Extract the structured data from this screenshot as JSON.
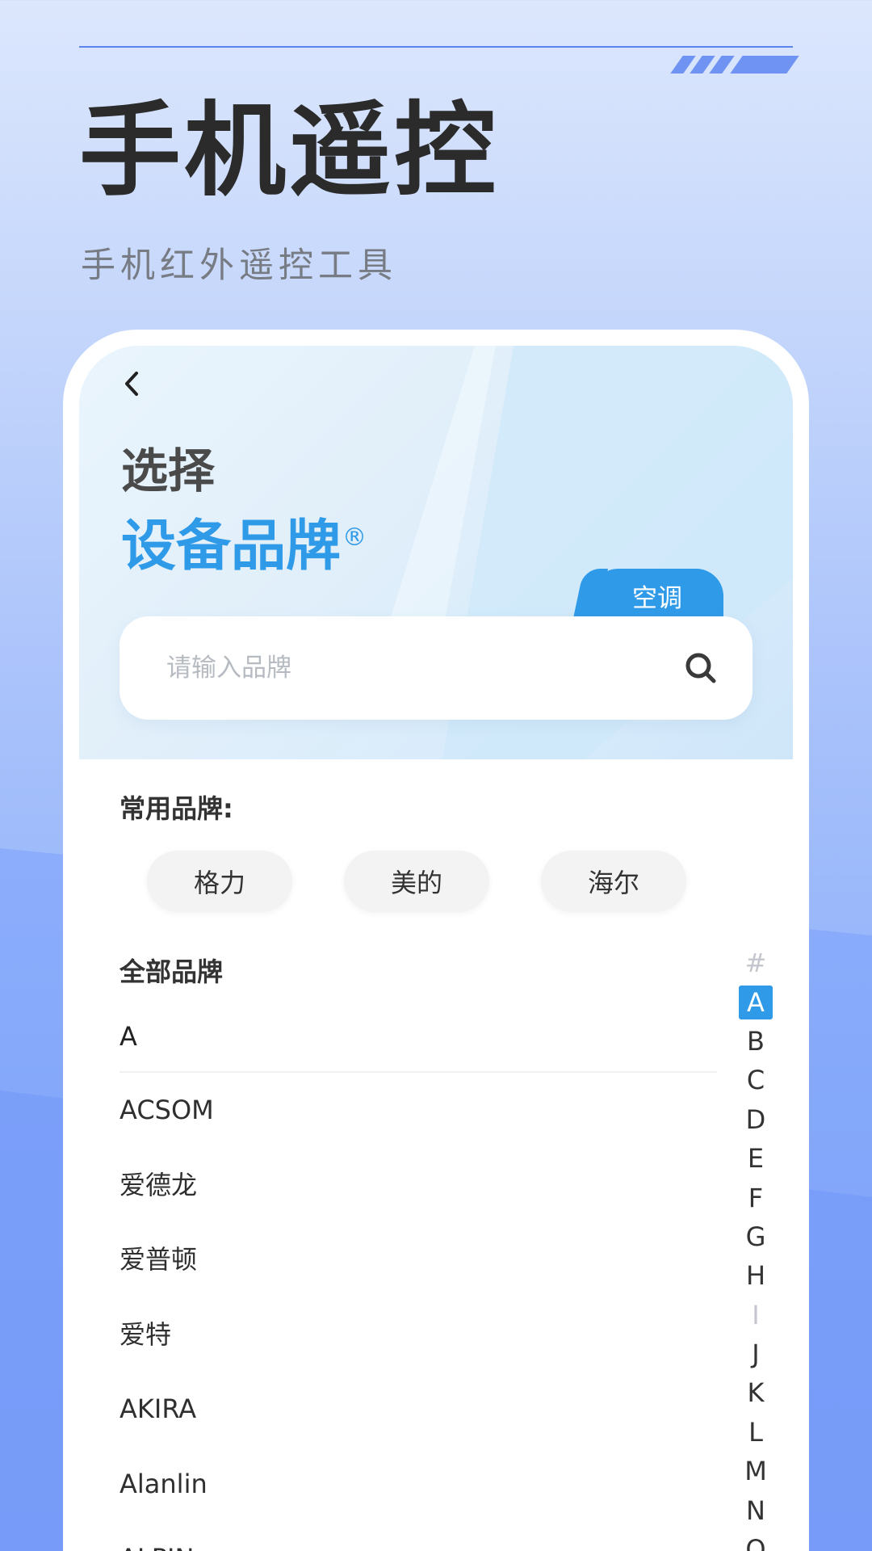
{
  "promo": {
    "title": "手机遥控",
    "subtitle": "手机红外遥控工具"
  },
  "header": {
    "title_line1": "选择",
    "title_line2": "设备品牌",
    "registered_mark": "®",
    "category_tab": "空调"
  },
  "search": {
    "placeholder": "请输入品牌",
    "value": ""
  },
  "common_brands": {
    "label": "常用品牌:",
    "items": [
      "格力",
      "美的",
      "海尔"
    ]
  },
  "all_brands": {
    "label": "全部品牌",
    "current_letter": "A",
    "items": [
      "ACSOM",
      "爱德龙",
      "爱普顿",
      "爱特",
      "AKIRA",
      "Alanlin",
      "ALPIN"
    ]
  },
  "index_bar": {
    "letters": [
      "#",
      "A",
      "B",
      "C",
      "D",
      "E",
      "F",
      "G",
      "H",
      "I",
      "J",
      "K",
      "L",
      "M",
      "N",
      "O"
    ],
    "active": "A"
  },
  "colors": {
    "accent": "#2f9ae8",
    "promo_line": "#5b84ef"
  },
  "icons": {
    "back": "chevron-left-icon",
    "search": "search-icon"
  }
}
